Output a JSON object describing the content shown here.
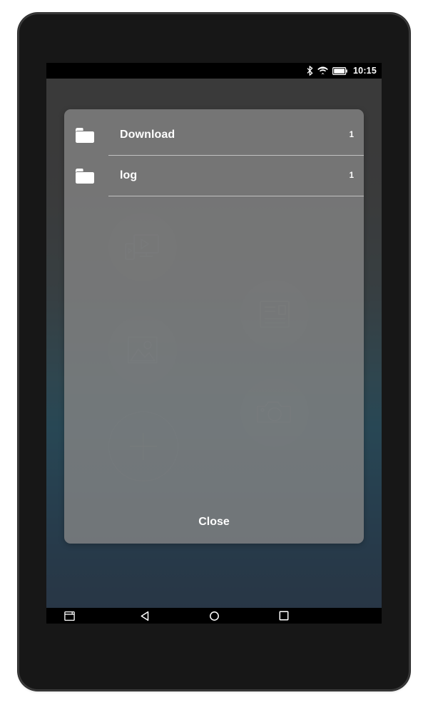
{
  "device": {
    "type": "android-tablet",
    "bezel_color": "#171717"
  },
  "status_bar": {
    "clock": "10:15",
    "icons": [
      {
        "name": "bluetooth-icon",
        "label": "Bluetooth"
      },
      {
        "name": "wifi-icon",
        "label": "Wi-Fi"
      },
      {
        "name": "battery-icon",
        "label": "Battery"
      }
    ]
  },
  "wallpaper": {
    "gradient_top": "#3a3a3a",
    "gradient_mid": "#0b5d80",
    "gradient_bottom": "#0b3158",
    "decor_icons": [
      {
        "name": "cast-video-icon",
        "label": "Cast video"
      },
      {
        "name": "article-icon",
        "label": "Article"
      },
      {
        "name": "image-icon",
        "label": "Image"
      },
      {
        "name": "camera-icon",
        "label": "Camera"
      },
      {
        "name": "add-plus-icon",
        "label": "Add"
      }
    ]
  },
  "dialog": {
    "background_color": "#848484",
    "folders": [
      {
        "icon": "folder-icon",
        "name": "Download",
        "count": "1"
      },
      {
        "icon": "folder-icon",
        "name": "log",
        "count": "1"
      }
    ],
    "close_label": "Close"
  },
  "navigation_bar": {
    "background_color": "#000000",
    "buttons": [
      {
        "name": "nav-screenshot-button",
        "label": "Screenshot"
      },
      {
        "name": "nav-back-button",
        "label": "Back"
      },
      {
        "name": "nav-home-button",
        "label": "Home"
      },
      {
        "name": "nav-recents-button",
        "label": "Recents"
      }
    ]
  }
}
